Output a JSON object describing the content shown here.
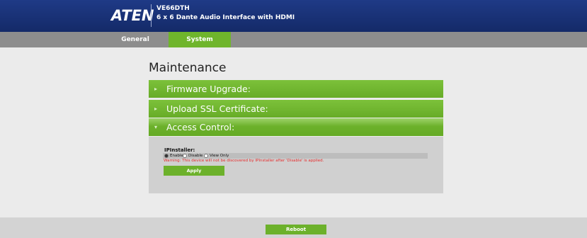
{
  "header": {
    "brand": "ATEN",
    "model": "VE66DTH",
    "subtitle": "6 x 6 Dante Audio Interface with HDMI"
  },
  "tabs": [
    {
      "label": "General",
      "active": false
    },
    {
      "label": "System",
      "active": true
    }
  ],
  "main": {
    "title": "Maintenance",
    "sections": [
      {
        "label": "Firmware Upgrade:",
        "expanded": false
      },
      {
        "label": "Upload SSL Certificate:",
        "expanded": false
      },
      {
        "label": "Access Control:",
        "expanded": true
      }
    ],
    "access_control": {
      "ipinstaller_label": "IPInstaller:",
      "options": [
        {
          "label": "Enable",
          "selected": true
        },
        {
          "label": "Disable",
          "selected": false
        },
        {
          "label": "View Only",
          "selected": false
        }
      ],
      "warning": "Warning: This device will not be discovered by IPInstaller after 'Disable' is applied.",
      "apply_label": "Apply"
    }
  },
  "footer": {
    "reboot_label": "Reboot"
  },
  "colors": {
    "header_blue": "#1f3a86",
    "accent_green": "#6cb12b",
    "tabbar_gray": "#8d8d8d",
    "warning_red": "#e52b2b"
  }
}
